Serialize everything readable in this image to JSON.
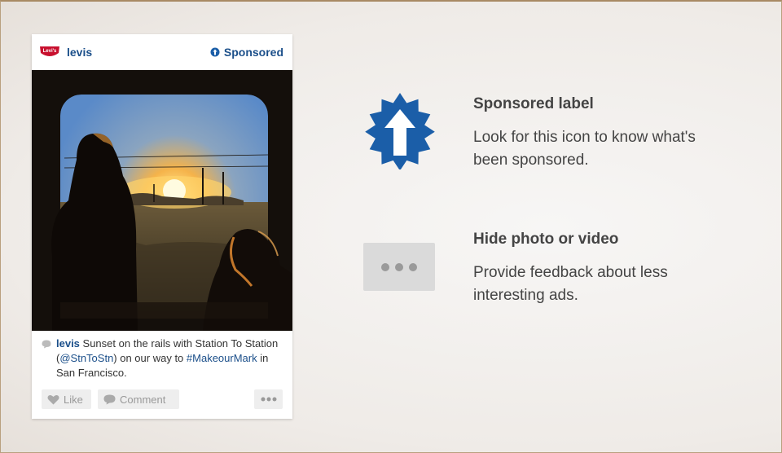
{
  "post": {
    "brand_name": "levis",
    "logo_text": "Levi's",
    "sponsored_label": "Sponsored",
    "caption": {
      "user": "levis",
      "text_1": " Sunset on the rails with Station To Station (",
      "mention": "@StnToStn",
      "text_2": ") on our way to ",
      "hashtag": "#MakeourMark",
      "text_3": " in San Francisco."
    },
    "actions": {
      "like_label": "Like",
      "comment_label": "Comment"
    }
  },
  "features": [
    {
      "title": "Sponsored label",
      "description": "Look for this icon to know what's been sponsored.",
      "icon": "sponsored-badge-icon"
    },
    {
      "title": "Hide photo or video",
      "description": "Provide feedback about less interesting ads.",
      "icon": "more-options-icon"
    }
  ],
  "colors": {
    "brand_blue": "#1b5ea8",
    "link_blue": "#1b4f8a",
    "text_dark": "#444444"
  }
}
